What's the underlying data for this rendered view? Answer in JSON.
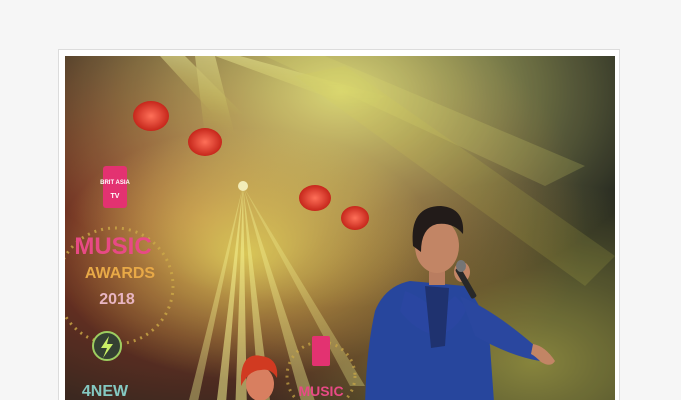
{
  "photo": {
    "alt_subject": "performer-on-stage",
    "logo": {
      "brand_top": "BRIT ASIA",
      "brand_sub": "TV",
      "title": "MUSIC",
      "subtitle": "AWARDS",
      "year": "2018",
      "sponsor": "4NEW"
    },
    "colors": {
      "stage_red": "#c0391e",
      "stage_yellow": "#d9d84a",
      "suit_blue": "#1f3f9a",
      "logo_pink": "#e22a6c"
    }
  }
}
